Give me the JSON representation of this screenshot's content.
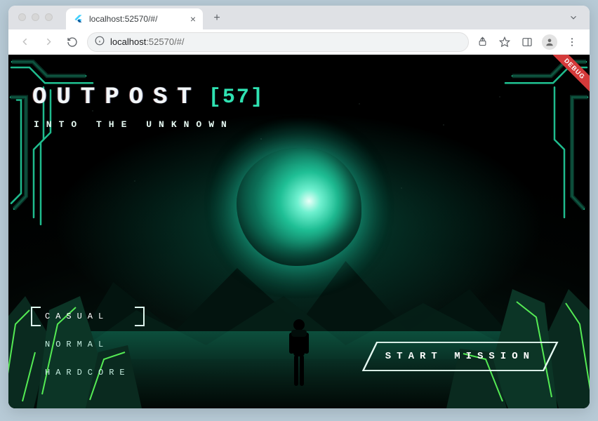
{
  "browser": {
    "tab": {
      "title": "localhost:52570/#/"
    },
    "url": {
      "host": "localhost",
      "rest": ":52570/#/"
    }
  },
  "debug_ribbon": "DEBUG",
  "game": {
    "title_main": "OUTPOST",
    "title_badge": "[57]",
    "subtitle": "INTO THE UNKNOWN",
    "difficulties": [
      {
        "label": "CASUAL",
        "selected": true
      },
      {
        "label": "NORMAL",
        "selected": false
      },
      {
        "label": "HARDCORE",
        "selected": false
      }
    ],
    "start_label": "START MISSION",
    "accent_color": "#29e2af"
  }
}
